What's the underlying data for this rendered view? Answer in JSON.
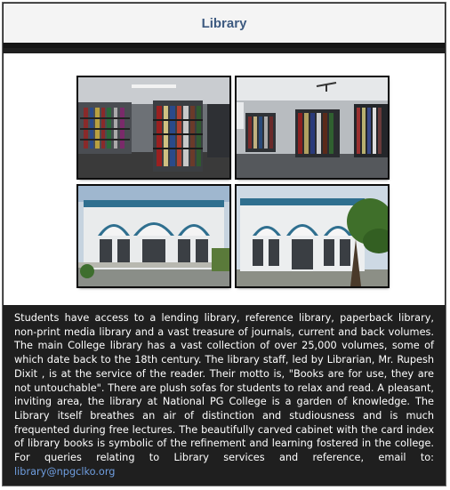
{
  "header": {
    "title": "Library"
  },
  "gallery": {
    "photos": [
      {
        "name": "library-shelves-photo-1"
      },
      {
        "name": "library-shelves-photo-2"
      },
      {
        "name": "library-building-exterior-photo-1"
      },
      {
        "name": "library-building-exterior-photo-2"
      }
    ]
  },
  "description": {
    "body": "Students have access to a lending library, reference library, paperback library, non-print media library and a vast treasure of journals, current and back volumes. The main College library has a vast collection of over 25,000 volumes, some of which date back to the 18th century. The library staff, led by Librarian, Mr. Rupesh Dixit , is at the service of the reader. Their motto is, \"Books are for use, they are not untouchable\". There are plush sofas for students to relax and read. A pleasant, inviting area, the library at National PG College is a garden of knowledge. The Library itself breathes an air of distinction and studiousness and is much frequented during free lectures. The beautifully carved cabinet with the card index of library books is symbolic of the refinement and learning fostered in the college. For queries relating to Library services and reference, email to: ",
    "email": "library@npgclko.org"
  },
  "colors": {
    "title": "#3d5a80",
    "link": "#6f9ee0",
    "panel": "#1f1f1f",
    "header_bg": "#f4f4f4"
  }
}
